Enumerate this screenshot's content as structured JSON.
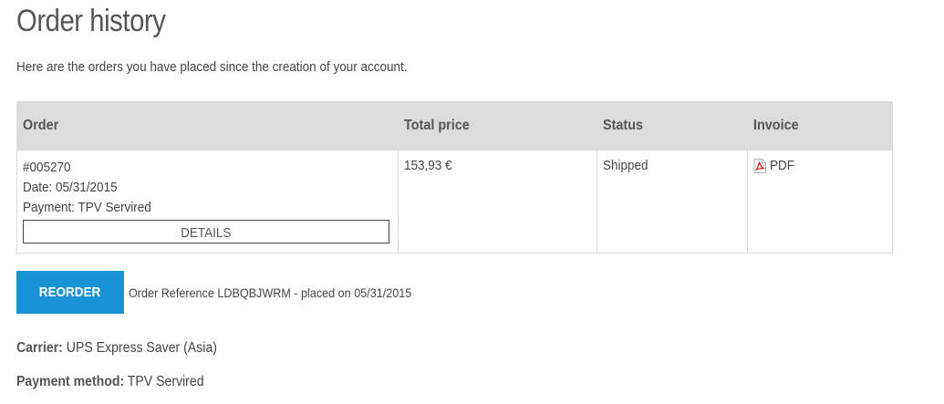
{
  "page": {
    "title": "Order history",
    "intro": "Here are the orders you have placed since the creation of your account."
  },
  "table": {
    "headers": {
      "order": "Order",
      "total": "Total price",
      "status": "Status",
      "invoice": "Invoice"
    },
    "rows": [
      {
        "order_number": "#005270",
        "date": "Date: 05/31/2015",
        "payment": "Payment: TPV Servired",
        "details_label": "DETAILS",
        "total": "153,93 €",
        "status": "Shipped",
        "invoice_label": "PDF",
        "invoice_icon": "pdf-icon"
      }
    ]
  },
  "reorder": {
    "button_label": "REORDER",
    "button_color": "#1a93d6",
    "reference_text": "Order Reference LDBQBJWRM - placed on 05/31/2015"
  },
  "details": {
    "carrier_label": "Carrier:",
    "carrier_value": "UPS Express Saver (Asia)",
    "payment_label": "Payment method:",
    "payment_value": "TPV Servired"
  }
}
